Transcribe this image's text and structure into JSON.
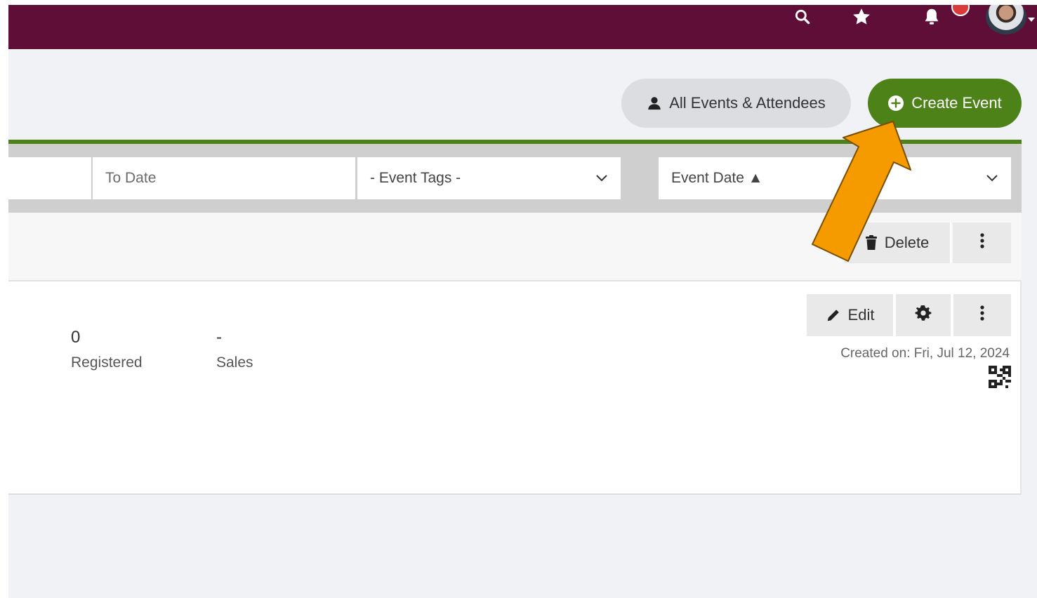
{
  "colors": {
    "topbar": "#5f0f37",
    "accent_green": "#4d8218",
    "annotation_arrow": "#f59b00"
  },
  "topbar": {
    "icons": [
      "search-icon",
      "star-icon",
      "bell-icon",
      "avatar"
    ]
  },
  "header": {
    "all_events_label": "All Events & Attendees",
    "create_event_label": "Create Event"
  },
  "filters": {
    "to_date_placeholder": "To Date",
    "event_tags_value": "- Event Tags -",
    "sort_value": "Event Date ▲"
  },
  "bulk_actions": {
    "delete_label": "Delete"
  },
  "event": {
    "registered_count": "0",
    "registered_label": "Registered",
    "sales_value": "-",
    "sales_label": "Sales",
    "edit_label": "Edit",
    "created_on": "Created on: Fri, Jul 12, 2024"
  }
}
